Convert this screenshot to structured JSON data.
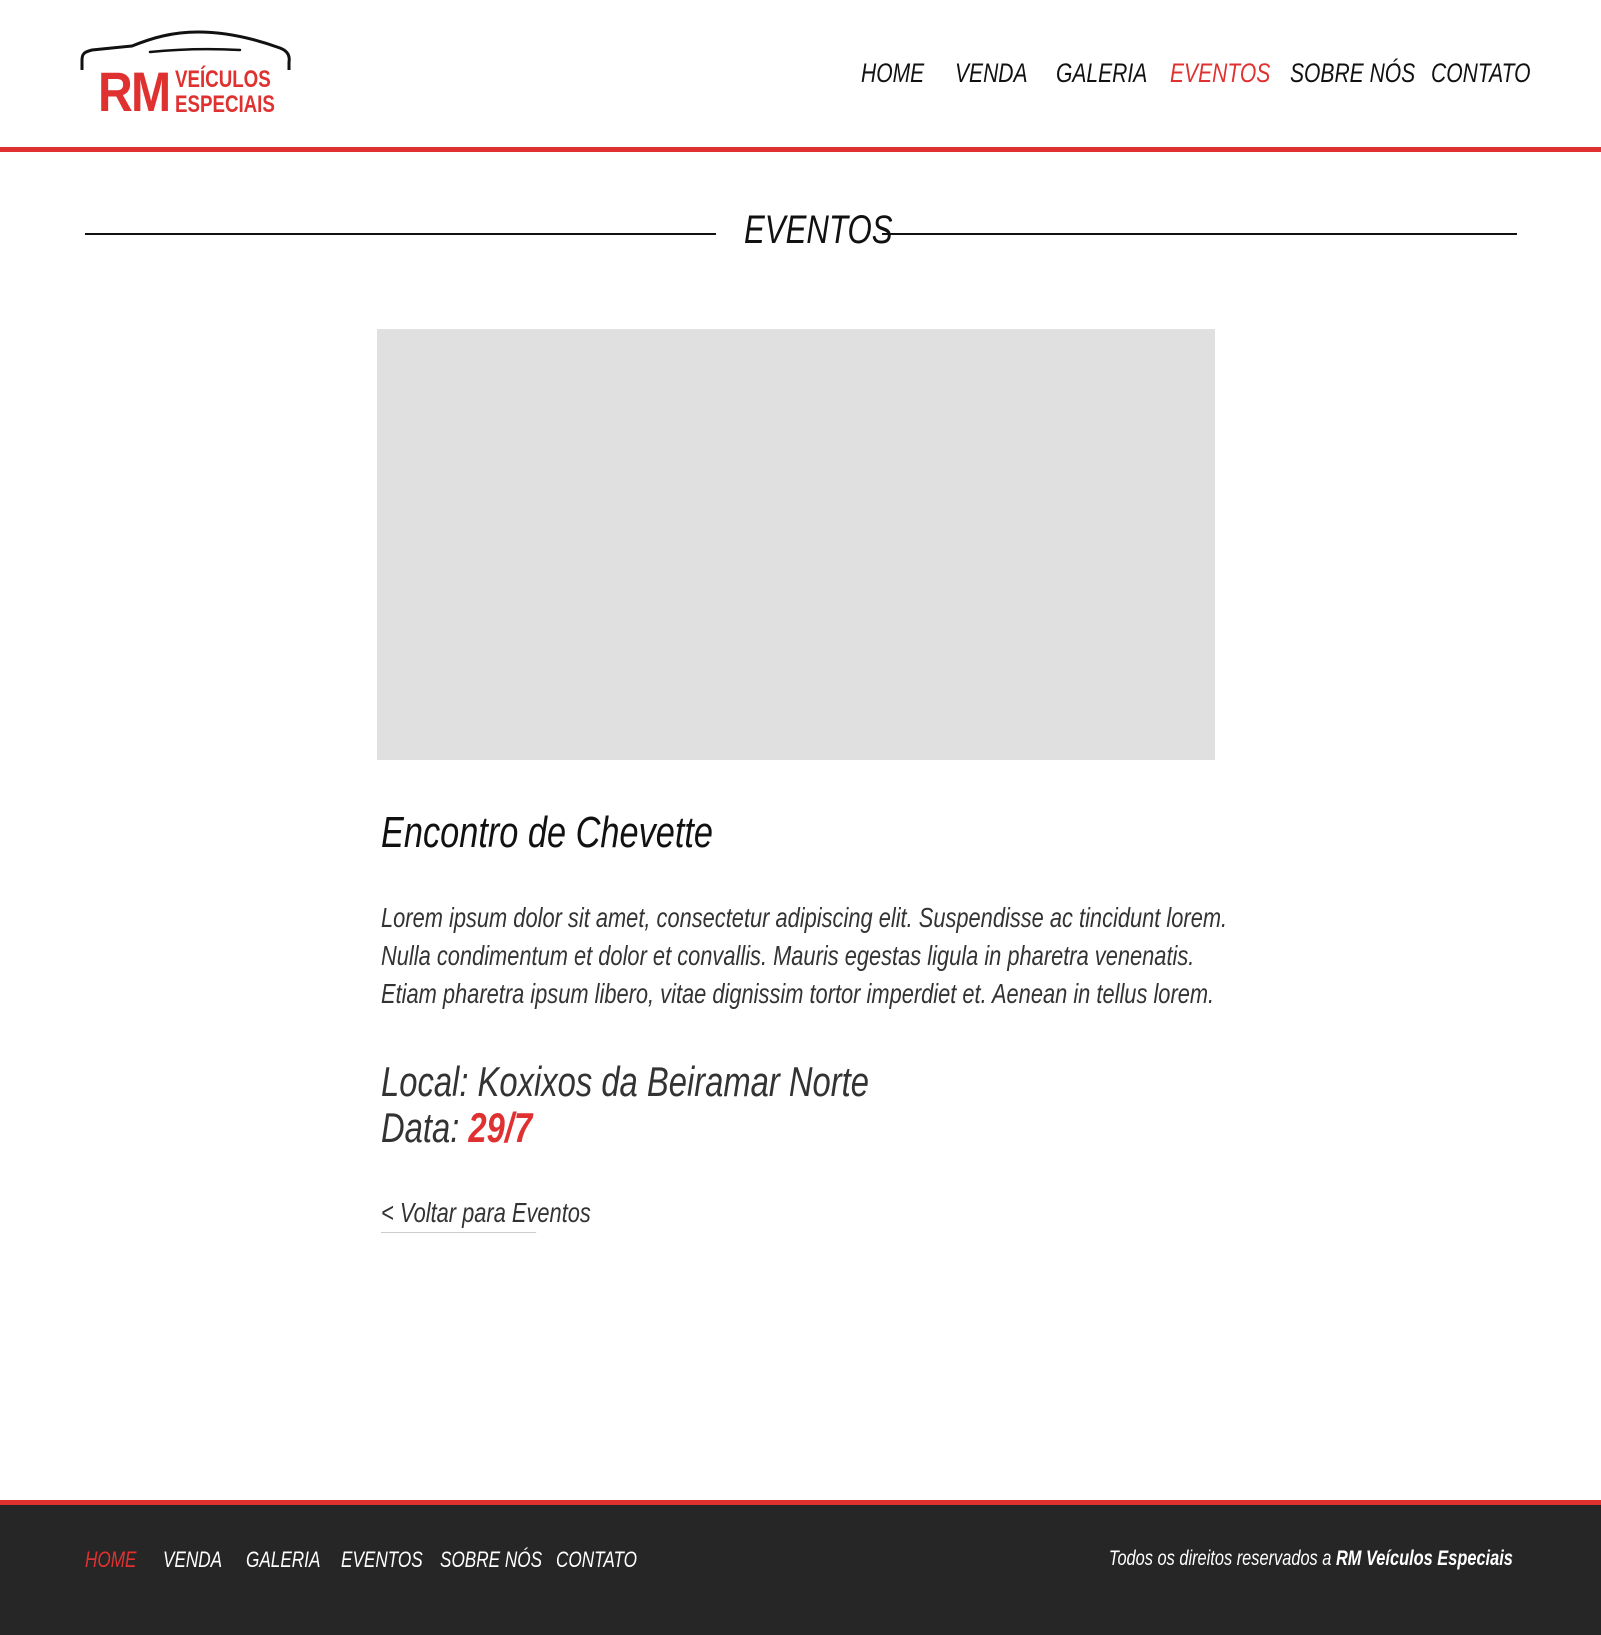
{
  "brand": {
    "logo_initials": "RM",
    "logo_line1": "VEÍCULOS",
    "logo_line2": "ESPECIAIS"
  },
  "nav": {
    "home": "HOME",
    "venda": "VENDA",
    "galeria": "GALERIA",
    "eventos": "EVENTOS",
    "sobre": "SOBRE NÓS",
    "contato": "CONTATO"
  },
  "section": {
    "title": "EVENTOS"
  },
  "event": {
    "title": "Encontro de Chevette",
    "description_lines": [
      "Lorem ipsum dolor sit amet, consectetur adipiscing elit. Suspendisse ac tincidunt lorem.",
      "Nulla condimentum et dolor et convallis. Mauris egestas ligula in pharetra venenatis.",
      "Etiam pharetra ipsum libero, vitae dignissim tortor imperdiet et. Aenean in tellus lorem."
    ],
    "local_label": "Local:",
    "local_value": "Koxixos da Beiramar Norte",
    "date_label": "Data:",
    "date_value": "29/7",
    "back_link": "< Voltar para Eventos"
  },
  "footer": {
    "nav": {
      "home": "HOME",
      "venda": "VENDA",
      "galeria": "GALERIA",
      "eventos": "EVENTOS",
      "sobre": "SOBRE NÓS",
      "contato": "CONTATO"
    },
    "rights_text": "Todos os direitos reservados a",
    "rights_brand": "RM Veículos Especiais"
  },
  "colors": {
    "accent": "#e03131",
    "footer_bg": "#262626",
    "image_placeholder": "#e0e0e0"
  }
}
